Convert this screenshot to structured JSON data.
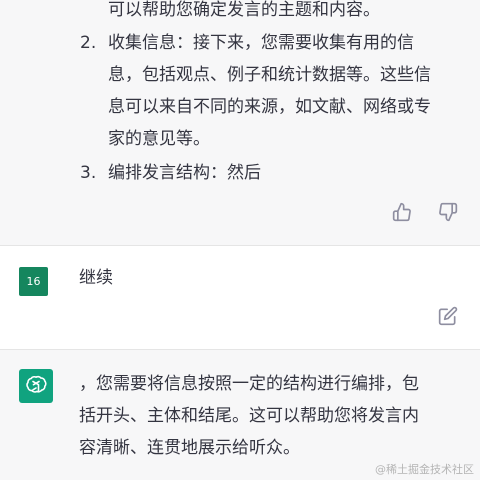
{
  "assistant_reply_1": {
    "line_0": "可以帮助您确定发言的主题和内容。",
    "items": [
      {
        "number": "2.",
        "lines": [
          "收集信息：接下来，您需要收集有用的信",
          "息，包括观点、例子和统计数据等。这些信",
          "息可以来自不同的来源，如文献、网络或专",
          "家的意见等。"
        ]
      },
      {
        "number": "3.",
        "lines": [
          "编排发言结构：然后"
        ]
      }
    ]
  },
  "user_message": {
    "avatar_text": "16",
    "text": "继续"
  },
  "assistant_reply_2": {
    "lines": [
      "，您需要将信息按照一定的结构进行编排，包",
      "括开头、主体和结尾。这可以帮助您将发言内",
      "容清晰、连贯地展示给听众。"
    ]
  },
  "icons": {
    "thumbs_up": "thumbs-up-icon",
    "thumbs_down": "thumbs-down-icon",
    "edit": "edit-icon",
    "logo": "chatgpt-logo-icon"
  },
  "colors": {
    "assistant_bg": "#f7f7f8",
    "user_avatar": "#15865e",
    "bot_avatar": "#10a37f"
  },
  "watermark": "@稀土掘金技术社区"
}
